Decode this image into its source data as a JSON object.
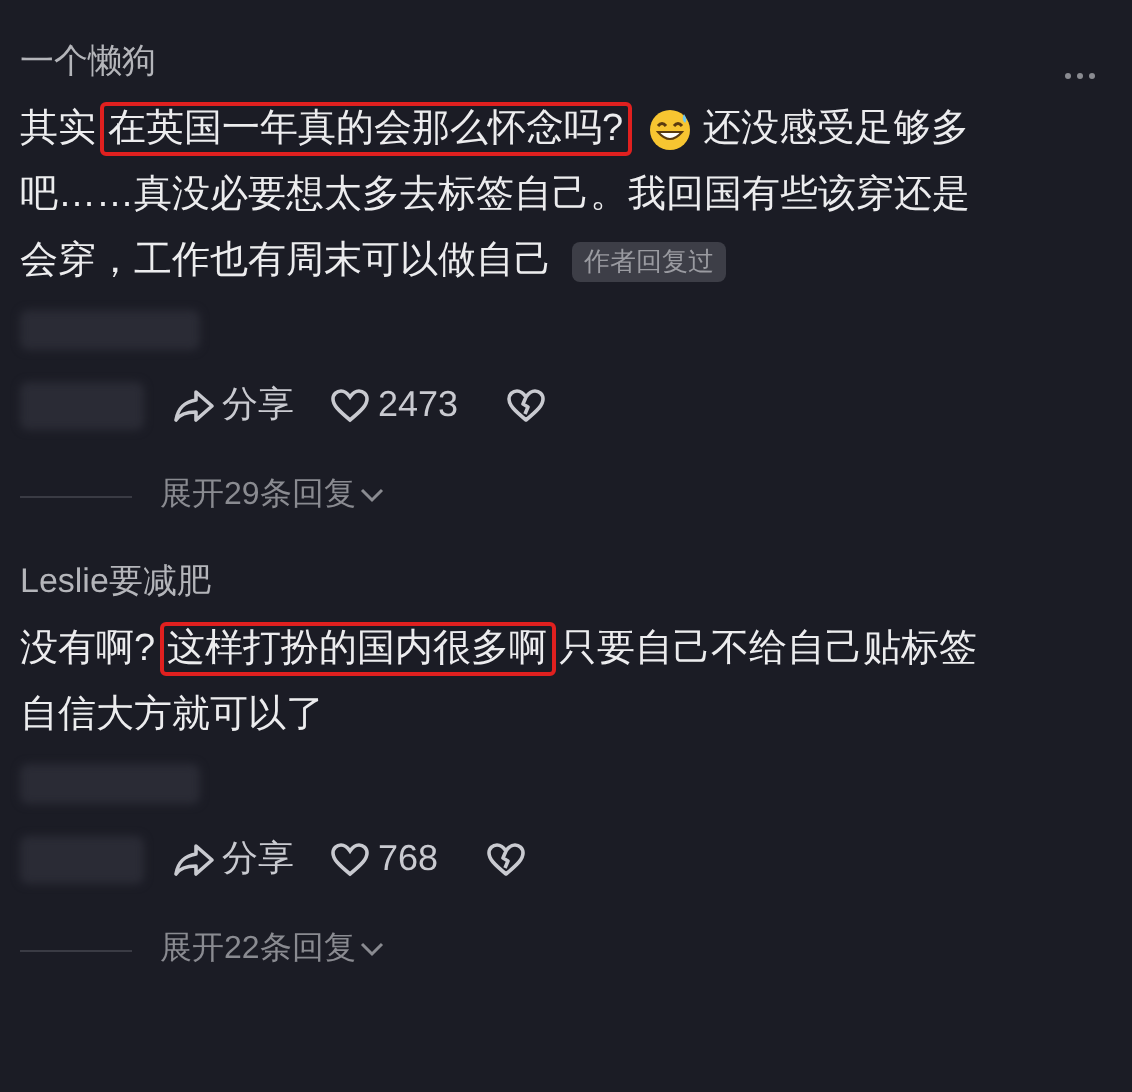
{
  "comments": [
    {
      "username": "一个懒狗",
      "has_more_menu": true,
      "body": [
        [
          {
            "kind": "text",
            "parts": [
              {
                "text": "其实",
                "highlighted": false
              },
              {
                "text": "在英国一年真的会那么怀念吗?",
                "highlighted": true
              }
            ]
          },
          {
            "kind": "emoji"
          },
          {
            "kind": "text",
            "parts": [
              {
                "text": "还没感受足够多",
                "highlighted": false
              }
            ]
          }
        ],
        [
          {
            "kind": "text",
            "parts": [
              {
                "text": "吧……真没必要想太多去标签自己。我回国有些该穿还是",
                "highlighted": false
              }
            ]
          }
        ],
        [
          {
            "kind": "text",
            "parts": [
              {
                "text": "会穿，工作也有周末可以做自己",
                "highlighted": false
              }
            ]
          },
          {
            "kind": "badge",
            "text": "作者回复过"
          }
        ]
      ],
      "share": "分享",
      "likes": "2473",
      "expand": "展开29条回复"
    },
    {
      "username": "Leslie要减肥",
      "has_more_menu": false,
      "body": [
        [
          {
            "kind": "text",
            "parts": [
              {
                "text": "没有啊?",
                "highlighted": false
              },
              {
                "text": "这样打扮的国内很多啊",
                "highlighted": true
              },
              {
                "text": "只要自己不给自己贴标签",
                "highlighted": false
              }
            ]
          }
        ],
        [
          {
            "kind": "text",
            "parts": [
              {
                "text": "自信大方就可以了",
                "highlighted": false
              }
            ]
          }
        ]
      ],
      "share": "分享",
      "likes": "768",
      "expand": "展开22条回复"
    }
  ]
}
